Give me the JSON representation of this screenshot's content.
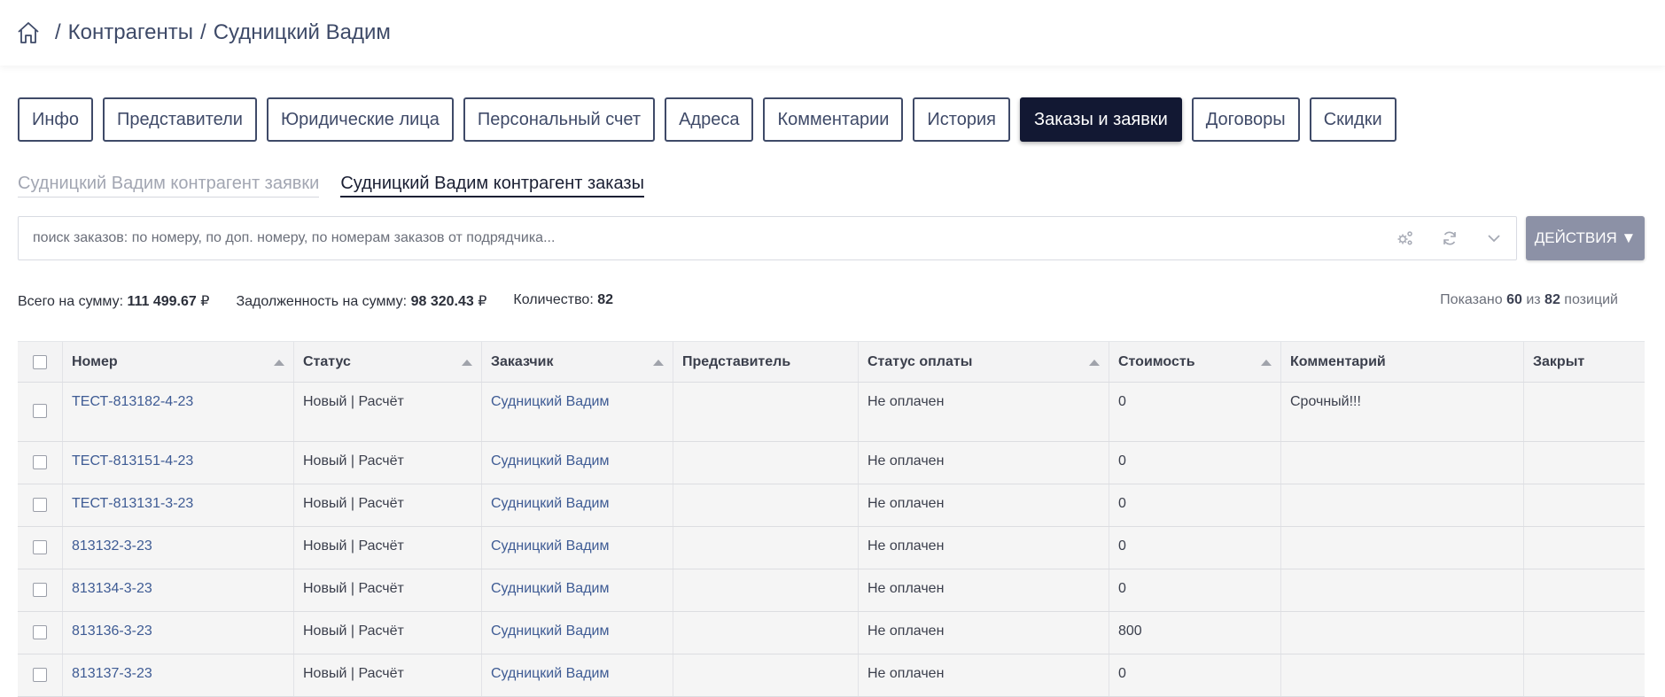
{
  "breadcrumb": {
    "home_icon": "home-icon",
    "items": [
      "Контрагенты",
      "Судницкий Вадим"
    ]
  },
  "tabs": [
    {
      "label": "Инфо",
      "active": false
    },
    {
      "label": "Представители",
      "active": false
    },
    {
      "label": "Юридические лица",
      "active": false
    },
    {
      "label": "Персональный счет",
      "active": false
    },
    {
      "label": "Адреса",
      "active": false
    },
    {
      "label": "Комментарии",
      "active": false
    },
    {
      "label": "История",
      "active": false
    },
    {
      "label": "Заказы и заявки",
      "active": true
    },
    {
      "label": "Договоры",
      "active": false
    },
    {
      "label": "Скидки",
      "active": false
    }
  ],
  "subtabs": [
    {
      "label": "Судницкий Вадим контрагент заявки",
      "active": false
    },
    {
      "label": "Судницкий Вадим контрагент заказы",
      "active": true
    }
  ],
  "search": {
    "placeholder": "поиск заказов: по номеру, по доп. номеру, по номерам заказов от подрядчика...",
    "value": ""
  },
  "actions": {
    "label": "ДЕЙСТВИЯ ▼"
  },
  "summary": {
    "total_label": "Всего на сумму:",
    "total_value": "111 499.67",
    "debt_label": "Задолженность на сумму:",
    "debt_value": "98 320.43",
    "currency": "₽",
    "count_label": "Количество:",
    "count_value": "82"
  },
  "shown": {
    "prefix": "Показано",
    "shown": "60",
    "of": "из",
    "total": "82",
    "suffix": "позиций"
  },
  "table": {
    "columns": [
      "Номер",
      "Статус",
      "Заказчик",
      "Представитель",
      "Статус оплаты",
      "Стоимость",
      "Комментарий",
      "Закрыт"
    ],
    "rows": [
      {
        "number": "ТЕСТ-813182-4-23",
        "status": "Новый | Расчёт",
        "customer": "Судницкий Вадим",
        "rep": "",
        "payment": "Не оплачен",
        "cost": "0",
        "comment": "Срочный!!!",
        "closed": ""
      },
      {
        "number": "ТЕСТ-813151-4-23",
        "status": "Новый | Расчёт",
        "customer": "Судницкий Вадим",
        "rep": "",
        "payment": "Не оплачен",
        "cost": "0",
        "comment": "",
        "closed": ""
      },
      {
        "number": "ТЕСТ-813131-3-23",
        "status": "Новый | Расчёт",
        "customer": "Судницкий Вадим",
        "rep": "",
        "payment": "Не оплачен",
        "cost": "0",
        "comment": "",
        "closed": ""
      },
      {
        "number": "813132-3-23",
        "status": "Новый | Расчёт",
        "customer": "Судницкий Вадим",
        "rep": "",
        "payment": "Не оплачен",
        "cost": "0",
        "comment": "",
        "closed": ""
      },
      {
        "number": "813134-3-23",
        "status": "Новый | Расчёт",
        "customer": "Судницкий Вадим",
        "rep": "",
        "payment": "Не оплачен",
        "cost": "0",
        "comment": "",
        "closed": ""
      },
      {
        "number": "813136-3-23",
        "status": "Новый | Расчёт",
        "customer": "Судницкий Вадим",
        "rep": "",
        "payment": "Не оплачен",
        "cost": "800",
        "comment": "",
        "closed": ""
      },
      {
        "number": "813137-3-23",
        "status": "Новый | Расчёт",
        "customer": "Судницкий Вадим",
        "rep": "",
        "payment": "Не оплачен",
        "cost": "0",
        "comment": "",
        "closed": ""
      }
    ]
  },
  "colors": {
    "accent": "#121833",
    "link": "#3e5b94",
    "urgent": "#e0443a",
    "actions_bg": "#8c91a6"
  }
}
